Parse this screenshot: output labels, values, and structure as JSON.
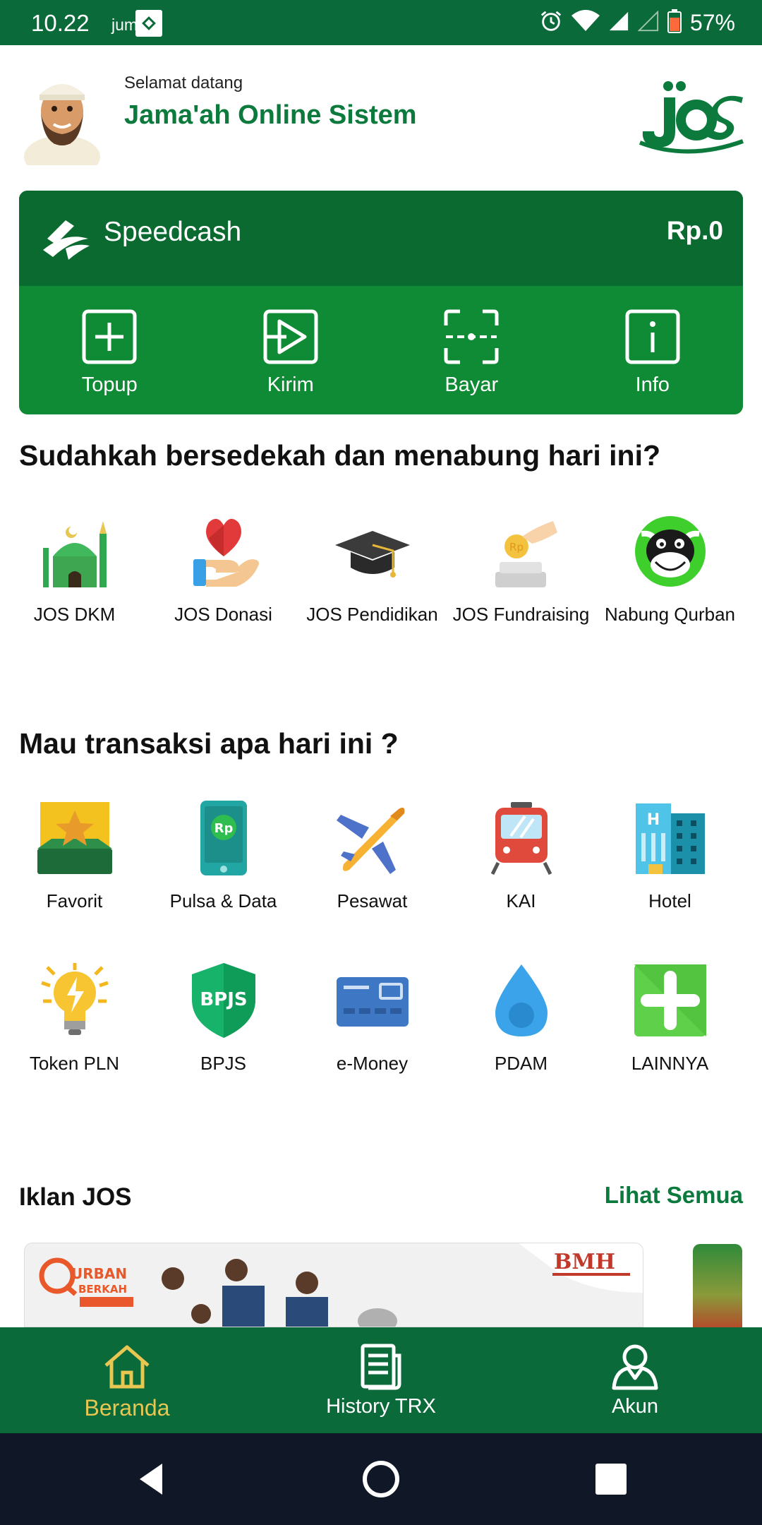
{
  "status_bar": {
    "time": "10.22",
    "day": "jum",
    "battery": "57%"
  },
  "header": {
    "welcome": "Selamat datang",
    "app_name": "Jama'ah Online Sistem"
  },
  "wallet": {
    "name": "Speedcash",
    "balance": "Rp.0",
    "actions": [
      {
        "label": "Topup",
        "icon": "plus-square-icon"
      },
      {
        "label": "Kirim",
        "icon": "send-icon"
      },
      {
        "label": "Bayar",
        "icon": "scan-icon"
      },
      {
        "label": "Info",
        "icon": "info-icon"
      }
    ]
  },
  "donation_section": {
    "title": "Sudahkah bersedekah dan menabung hari ini?",
    "items": [
      {
        "label": "JOS DKM",
        "icon": "mosque-icon"
      },
      {
        "label": "JOS Donasi",
        "icon": "heart-hand-icon"
      },
      {
        "label": "JOS Pendidikan",
        "icon": "graduation-cap-icon"
      },
      {
        "label": "JOS Fundraising",
        "icon": "coin-hand-icon"
      },
      {
        "label": "Nabung Qurban",
        "icon": "cow-icon"
      }
    ]
  },
  "transaction_section": {
    "title": "Mau transaksi apa hari ini ?",
    "row1": [
      {
        "label": "Favorit",
        "icon": "star-icon"
      },
      {
        "label": "Pulsa & Data",
        "icon": "phone-icon"
      },
      {
        "label": "Pesawat",
        "icon": "airplane-icon"
      },
      {
        "label": "KAI",
        "icon": "train-icon"
      },
      {
        "label": "Hotel",
        "icon": "hotel-icon"
      }
    ],
    "row2": [
      {
        "label": "Token PLN",
        "icon": "lightbulb-icon"
      },
      {
        "label": "BPJS",
        "icon": "shield-icon"
      },
      {
        "label": "e-Money",
        "icon": "card-icon"
      },
      {
        "label": "PDAM",
        "icon": "water-drop-icon"
      },
      {
        "label": "LAINNYA",
        "icon": "plus-icon"
      }
    ]
  },
  "ads": {
    "title": "Iklan JOS",
    "see_all": "Lihat Semua",
    "banner_brand": "BMH"
  },
  "bottom_nav": {
    "items": [
      {
        "label": "Beranda",
        "icon": "home-icon",
        "active": true
      },
      {
        "label": "History TRX",
        "icon": "document-icon",
        "active": false
      },
      {
        "label": "Akun",
        "icon": "user-icon",
        "active": false
      }
    ]
  },
  "colors": {
    "primary": "#0b6a3a",
    "card": "#0f8a35",
    "accent": "#e7c652"
  }
}
